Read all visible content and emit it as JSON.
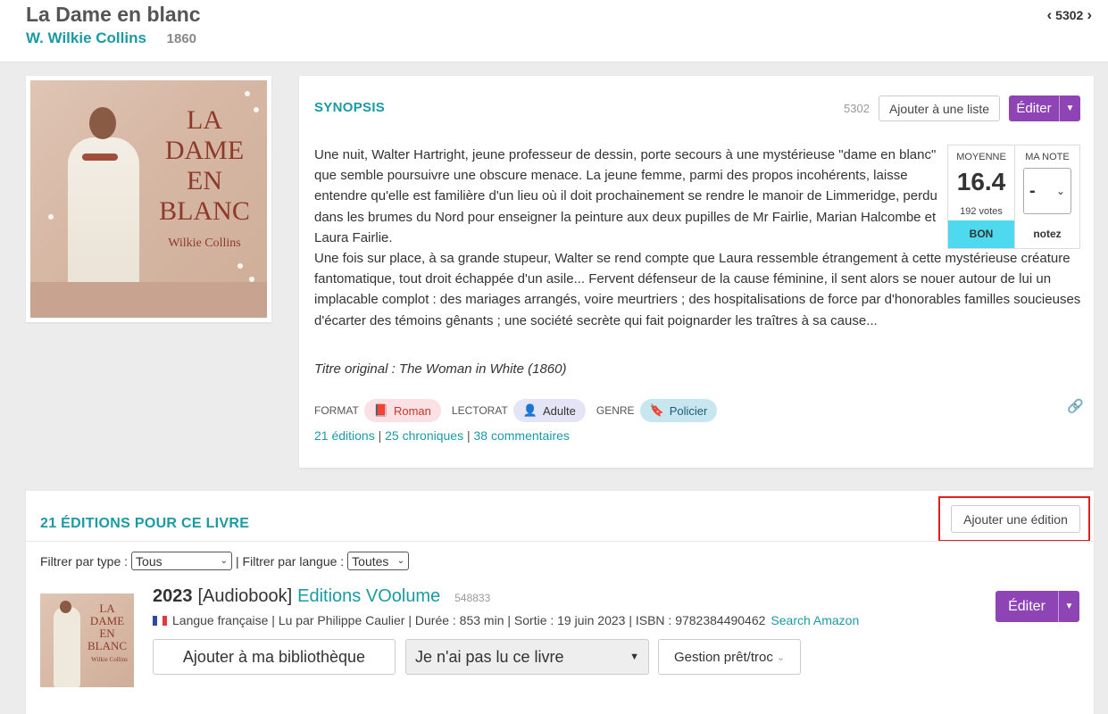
{
  "header": {
    "title": "La Dame en blanc",
    "author": "W. Wilkie Collins",
    "year": "1860",
    "book_id": "5302"
  },
  "cover": {
    "title_lines": [
      "LA",
      "DAME",
      "EN",
      "BLANC"
    ],
    "author": "Wilkie Collins"
  },
  "synopsis": {
    "heading": "SYNOPSIS",
    "id": "5302",
    "add_to_list": "Ajouter à une liste",
    "edit": "Éditer",
    "paragraph1": "Une nuit, Walter Hartright, jeune professeur de dessin, porte secours à une mystérieuse \"dame en blanc\" que semble poursuivre une obscure menace. La jeune femme, parmi des propos incohérents, laisse entendre qu'elle est familière d'un lieu où il doit prochainement se rendre le manoir de Limmeridge, perdu dans les brumes du Nord pour enseigner la peinture aux deux pupilles de Mr Fairlie, Marian Halcombe et Laura Fairlie.",
    "paragraph2": "Une fois sur place, à sa grande stupeur, Walter se rend compte que Laura ressemble étrangement à cette mystérieuse créature fantomatique, tout droit échappée d'un asile... Fervent défenseur de la cause féminine, il sent alors se nouer autour de lui un implacable complot : des mariages arrangés, voire meurtriers ; des hospitalisations de force par d'honorables familles soucieuses d'écarter des témoins gênants ; une société secrète qui fait poignarder les traîtres à sa cause...",
    "original_title": "Titre original : The Woman in White (1860)",
    "rating": {
      "avg_label": "MOYENNE",
      "avg_value": "16.4",
      "votes": "192 votes",
      "verdict": "BON",
      "my_label": "MA NOTE",
      "my_value": "-",
      "my_cta": "notez",
      "verdict_color": "#4fd9ee"
    },
    "tags": {
      "format_label": "FORMAT",
      "format_value": "Roman",
      "lectorat_label": "LECTORAT",
      "lectorat_value": "Adulte",
      "genre_label": "GENRE",
      "genre_value": "Policier"
    },
    "links": {
      "editions": "21 éditions",
      "chroniques": "25 chroniques",
      "commentaires": "38 commentaires",
      "sep": "|"
    }
  },
  "editions": {
    "heading": "21 ÉDITIONS POUR CE LIVRE",
    "add_edition": "Ajouter une édition",
    "filter_type_label": "Filtrer par type :",
    "filter_type_value": "Tous",
    "filter_lang_label": "| Filtrer par langue :",
    "filter_lang_value": "Toutes",
    "item": {
      "year": "2023",
      "type": "[Audiobook]",
      "publisher": "Editions VOolume",
      "id": "548833",
      "meta": "Langue française | Lu par Philippe Caulier | Durée : 853 min | Sortie : 19 juin 2023 | ISBN : 9782384490462",
      "amazon": "Search Amazon",
      "edit": "Éditer",
      "add_library": "Ajouter à ma bibliothèque",
      "read_status": "Je n'ai pas lu ce livre",
      "loan": "Gestion prêt/troc",
      "thumb_title": [
        "LA",
        "DAME",
        "EN",
        "BLANC"
      ],
      "thumb_author": "Wilkie Collins"
    }
  },
  "colors": {
    "accent": "#1a9aa4",
    "purple": "#8e44b5",
    "highlight_border": "#e02020"
  }
}
